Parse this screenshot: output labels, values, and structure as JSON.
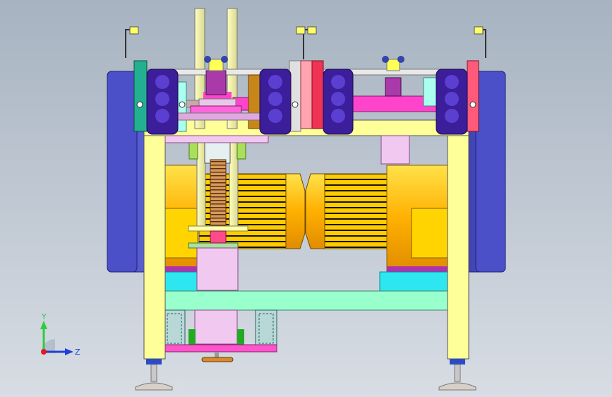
{
  "viewport": {
    "background_top": "#a7b3c1",
    "background_bottom": "#d8dde4"
  },
  "triad": {
    "y_label": "Y",
    "z_label": "Z",
    "y_color": "#2ecc40",
    "z_color": "#1f3fd6",
    "x_color": "#e31a1a"
  },
  "palette": {
    "frame_yellow": "#ffff99",
    "motor_gold": "#ffb000",
    "motor_body": "#ffd400",
    "side_blue": "#4a4fc4",
    "cyan_block": "#2ee6f0",
    "mint": "#99ffcc",
    "magenta": "#ff33cc",
    "purple_roller": "#3c1d9a",
    "pink": "#e6a0e6",
    "green_bolt": "#22aa22",
    "tan_screw": "#d4a06a"
  }
}
